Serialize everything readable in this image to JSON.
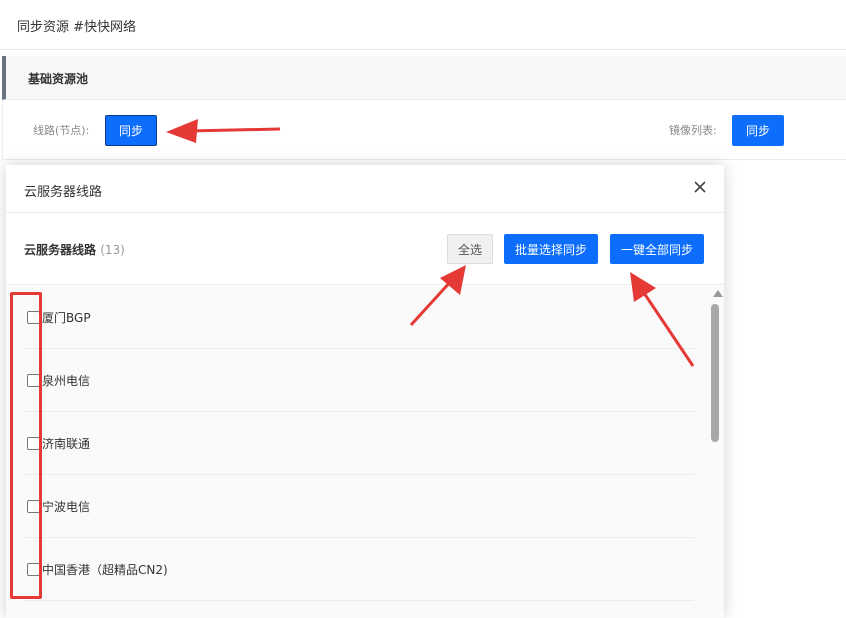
{
  "topbar": {
    "title": "同步资源 #快快网络"
  },
  "section": {
    "title": "基础资源池"
  },
  "sync_row": {
    "route_label": "线路(节点):",
    "route_button": "同步",
    "mirror_label": "镜像列表:",
    "mirror_button": "同步"
  },
  "modal": {
    "title": "云服务器线路",
    "list_title": "云服务器线路",
    "list_count": "(13)",
    "select_all": "全选",
    "batch_sync": "批量选择同步",
    "sync_all": "一键全部同步",
    "items": [
      {
        "label": "厦门BGP",
        "checked": false
      },
      {
        "label": "泉州电信",
        "checked": false
      },
      {
        "label": "济南联通",
        "checked": false
      },
      {
        "label": "宁波电信",
        "checked": false
      },
      {
        "label": "中国香港（超精品CN2)",
        "checked": false
      }
    ]
  },
  "colors": {
    "primary": "#0d6efd",
    "annotation": "#e53935",
    "section_accent": "#6b7280"
  },
  "icons": {
    "close": "close-icon",
    "scroll_up": "scroll-up-arrow-icon"
  }
}
